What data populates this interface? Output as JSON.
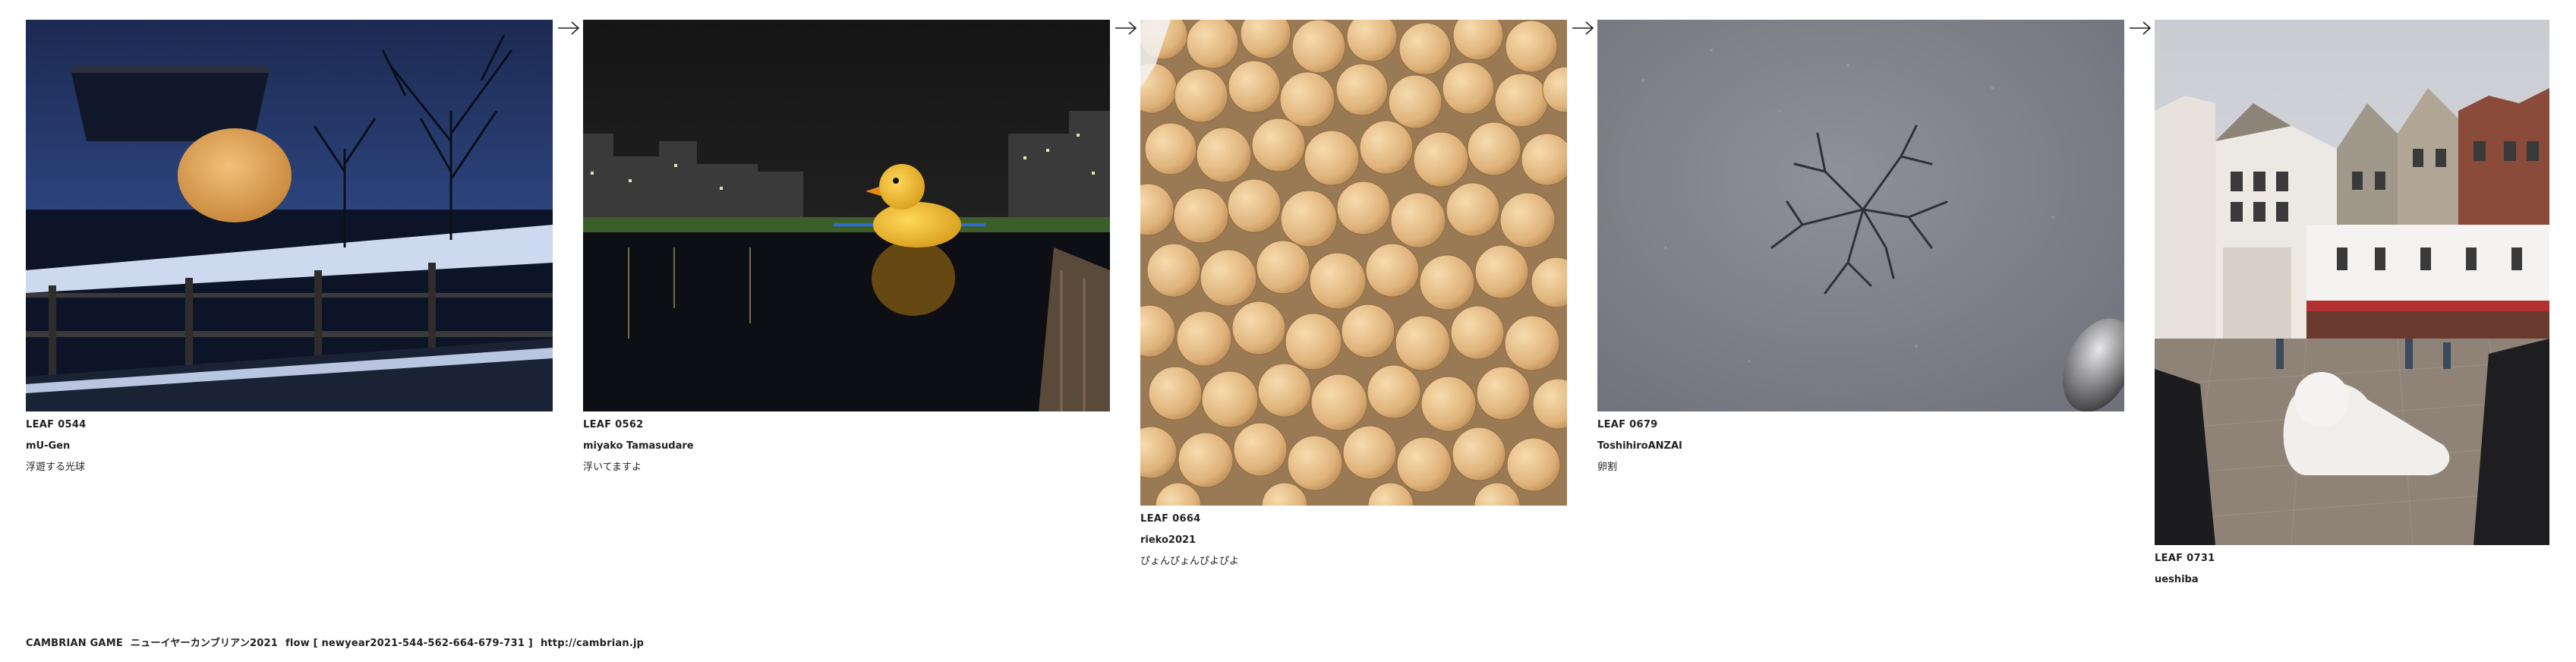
{
  "leaves": [
    {
      "id": "LEAF 0544",
      "author": "mU-Gen",
      "title": "浮遊する光球",
      "photo_icon": "night-orb-photo"
    },
    {
      "id": "LEAF 0562",
      "author": "miyako Tamasudare",
      "title": "浮いてますよ",
      "photo_icon": "rubber-duck-photo"
    },
    {
      "id": "LEAF 0664",
      "author": "rieko2021",
      "title": "ぴょんぴょんぴよぴよ",
      "photo_icon": "chickpeas-photo"
    },
    {
      "id": "LEAF 0679",
      "author": "ToshihiroANZAI",
      "title": "卵割",
      "photo_icon": "asphalt-crack-photo"
    },
    {
      "id": "LEAF 0731",
      "author": "ueshiba",
      "title": "",
      "photo_icon": "town-square-photo"
    }
  ],
  "arrow_icon": "right-arrow-icon",
  "footer": {
    "game": "CAMBRIAN GAME",
    "event": "ニューイヤーカンブリアン2021",
    "flow": "flow [ newyear2021-544-562-664-679-731 ]",
    "url": "http://cambrian.jp"
  }
}
